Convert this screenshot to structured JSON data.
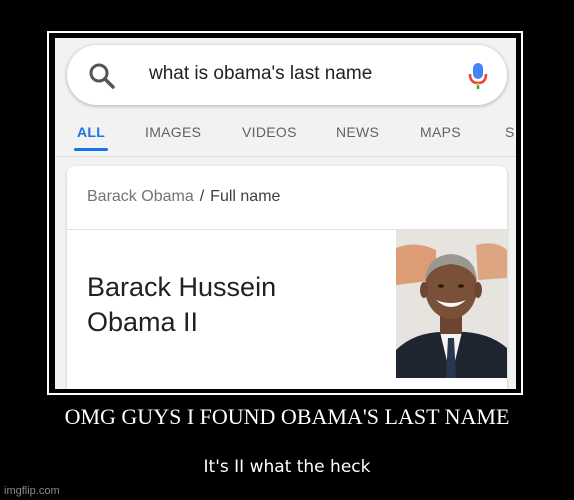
{
  "search": {
    "query": "what is obama's last name"
  },
  "tabs": [
    {
      "label": "ALL",
      "active": true
    },
    {
      "label": "IMAGES",
      "active": false
    },
    {
      "label": "VIDEOS",
      "active": false
    },
    {
      "label": "NEWS",
      "active": false
    },
    {
      "label": "MAPS",
      "active": false
    },
    {
      "label": "S",
      "active": false
    }
  ],
  "card": {
    "breadcrumb_entity": "Barack Obama",
    "breadcrumb_separator": "/",
    "breadcrumb_attribute": "Full name",
    "answer_line1": "Barack Hussein",
    "answer_line2": "Obama II"
  },
  "caption": {
    "title": "OMG GUYS I FOUND OBAMA'S LAST NAME",
    "subtitle": "It's II what the heck"
  },
  "watermark": "imgflip.com",
  "colors": {
    "google_blue": "#4285F4",
    "google_red": "#EA4335",
    "google_yellow": "#FBBC05",
    "google_green": "#34A853",
    "active_tab": "#1a73e8"
  },
  "icons": [
    "search-icon",
    "microphone-icon"
  ]
}
